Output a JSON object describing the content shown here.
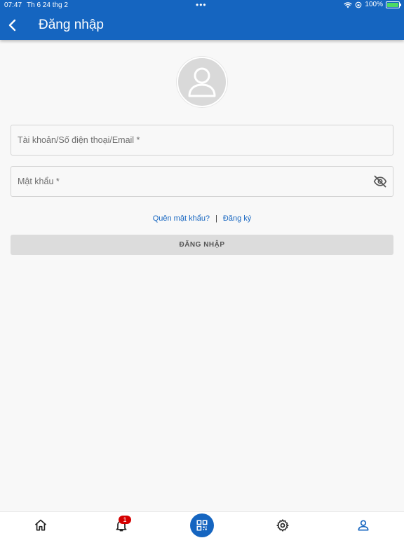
{
  "status_bar": {
    "time": "07:47",
    "date": "Th 6 24 thg 2",
    "dots": "•••",
    "battery_text": "100%"
  },
  "header": {
    "title": "Đăng nhập",
    "background_color": "#1565c0"
  },
  "form": {
    "account_placeholder": "Tài khoản/Số điện thoại/Email *",
    "account_value": "",
    "password_placeholder": "Mật khẩu *",
    "password_value": ""
  },
  "links": {
    "forgot_password": "Quên mật khẩu?",
    "separator": "|",
    "register": "Đăng ký"
  },
  "login_button_label": "ĐĂNG NHẬP",
  "bottom_nav": {
    "items": [
      "home-icon",
      "bell-icon",
      "qr-code-icon",
      "gear-icon",
      "person-icon"
    ],
    "notification_count": "1",
    "active_color": "#1565c0"
  }
}
